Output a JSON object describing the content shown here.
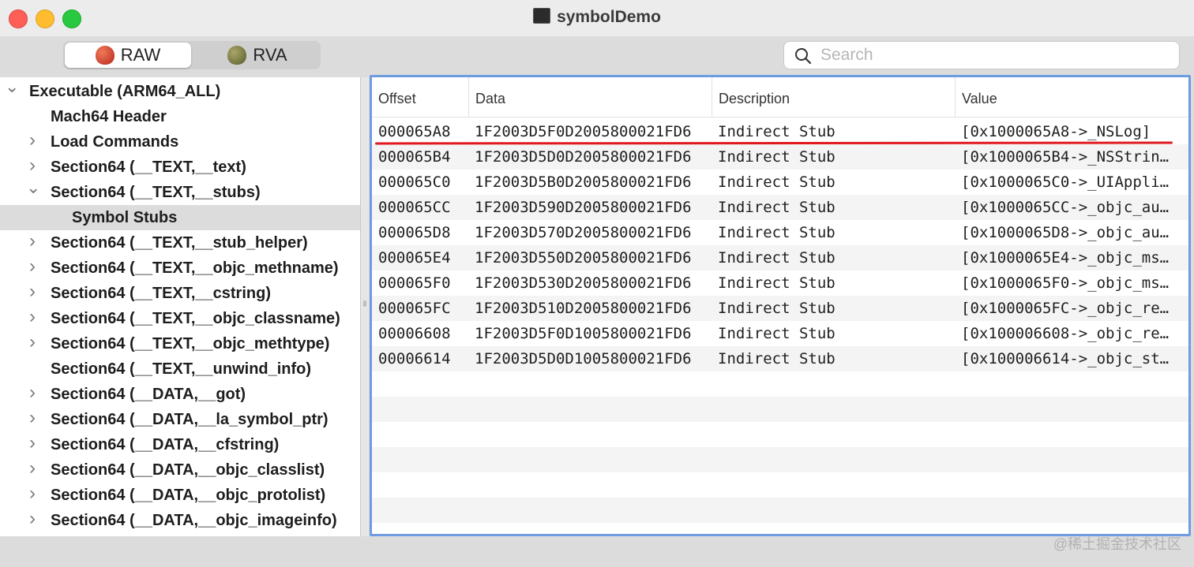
{
  "window": {
    "title": "symbolDemo",
    "title_icon": "terminal-icon"
  },
  "toolbar": {
    "segments": [
      {
        "label": "RAW",
        "icon": "red-apple-icon",
        "selected": true
      },
      {
        "label": "RVA",
        "icon": "olive-apple-icon",
        "selected": false
      }
    ],
    "search": {
      "placeholder": "Search",
      "value": "",
      "icon": "search-icon"
    }
  },
  "sidebar": {
    "items": [
      {
        "label": "Executable  (ARM64_ALL)",
        "level": 0,
        "chevron": "down",
        "selected": false
      },
      {
        "label": "Mach64 Header",
        "level": 1,
        "chevron": "none",
        "selected": false
      },
      {
        "label": "Load Commands",
        "level": 1,
        "chevron": "right",
        "selected": false
      },
      {
        "label": "Section64 (__TEXT,__text)",
        "level": 1,
        "chevron": "right",
        "selected": false
      },
      {
        "label": "Section64 (__TEXT,__stubs)",
        "level": 1,
        "chevron": "down",
        "selected": false
      },
      {
        "label": "Symbol Stubs",
        "level": 2,
        "chevron": "none",
        "selected": true
      },
      {
        "label": "Section64 (__TEXT,__stub_helper)",
        "level": 1,
        "chevron": "right",
        "selected": false
      },
      {
        "label": "Section64 (__TEXT,__objc_methname)",
        "level": 1,
        "chevron": "right",
        "selected": false
      },
      {
        "label": "Section64 (__TEXT,__cstring)",
        "level": 1,
        "chevron": "right",
        "selected": false
      },
      {
        "label": "Section64 (__TEXT,__objc_classname)",
        "level": 1,
        "chevron": "right",
        "selected": false
      },
      {
        "label": "Section64 (__TEXT,__objc_methtype)",
        "level": 1,
        "chevron": "right",
        "selected": false
      },
      {
        "label": "Section64 (__TEXT,__unwind_info)",
        "level": 1,
        "chevron": "none",
        "selected": false
      },
      {
        "label": "Section64 (__DATA,__got)",
        "level": 1,
        "chevron": "right",
        "selected": false
      },
      {
        "label": "Section64 (__DATA,__la_symbol_ptr)",
        "level": 1,
        "chevron": "right",
        "selected": false
      },
      {
        "label": "Section64 (__DATA,__cfstring)",
        "level": 1,
        "chevron": "right",
        "selected": false
      },
      {
        "label": "Section64 (__DATA,__objc_classlist)",
        "level": 1,
        "chevron": "right",
        "selected": false
      },
      {
        "label": "Section64 (__DATA,__objc_protolist)",
        "level": 1,
        "chevron": "right",
        "selected": false
      },
      {
        "label": "Section64 (__DATA,__objc_imageinfo)",
        "level": 1,
        "chevron": "right",
        "selected": false
      }
    ]
  },
  "table": {
    "columns": [
      "Offset",
      "Data",
      "Description",
      "Value"
    ],
    "rows": [
      [
        "000065A8",
        "1F2003D5F0D2005800021FD6",
        "Indirect Stub",
        "[0x1000065A8->_NSLog]"
      ],
      [
        "000065B4",
        "1F2003D5D0D2005800021FD6",
        "Indirect Stub",
        "[0x1000065B4->_NSStrin…"
      ],
      [
        "000065C0",
        "1F2003D5B0D2005800021FD6",
        "Indirect Stub",
        "[0x1000065C0->_UIAppli…"
      ],
      [
        "000065CC",
        "1F2003D590D2005800021FD6",
        "Indirect Stub",
        "[0x1000065CC->_objc_au…"
      ],
      [
        "000065D8",
        "1F2003D570D2005800021FD6",
        "Indirect Stub",
        "[0x1000065D8->_objc_au…"
      ],
      [
        "000065E4",
        "1F2003D550D2005800021FD6",
        "Indirect Stub",
        "[0x1000065E4->_objc_ms…"
      ],
      [
        "000065F0",
        "1F2003D530D2005800021FD6",
        "Indirect Stub",
        "[0x1000065F0->_objc_ms…"
      ],
      [
        "000065FC",
        "1F2003D510D2005800021FD6",
        "Indirect Stub",
        "[0x1000065FC->_objc_re…"
      ],
      [
        "00006608",
        "1F2003D5F0D1005800021FD6",
        "Indirect Stub",
        "[0x100006608->_objc_re…"
      ],
      [
        "00006614",
        "1F2003D5D0D1005800021FD6",
        "Indirect Stub",
        "[0x100006614->_objc_st…"
      ]
    ],
    "highlight_color": "#e0191f",
    "selection_border_color": "#6f9be0"
  },
  "watermark": "@稀土掘金技术社区"
}
